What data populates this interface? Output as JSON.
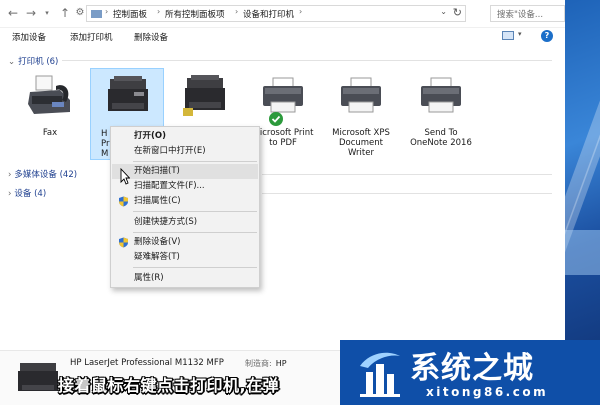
{
  "address": {
    "breadcrumbs": [
      "控制面板",
      "所有控制面板项",
      "设备和打印机"
    ],
    "search_placeholder": "搜索\"设备..."
  },
  "toolbar": {
    "add_device": "添加设备",
    "add_printer": "添加打印机",
    "remove_device": "删除设备"
  },
  "groups": {
    "printers": "打印机 (6)",
    "multimedia": "多媒体设备 (42)",
    "devices": "设备 (4)"
  },
  "devices": [
    {
      "label": "Fax",
      "icon": "fax-icon"
    },
    {
      "label": "H\nPr\nM",
      "icon": "mfp-printer-icon",
      "selected": true
    },
    {
      "label": "",
      "icon": "mfp-printer-icon"
    },
    {
      "label": "Microsoft Print\nto PDF",
      "icon": "printer-icon",
      "default": true
    },
    {
      "label": "Microsoft XPS\nDocument\nWriter",
      "icon": "printer-icon"
    },
    {
      "label": "Send To\nOneNote 2016",
      "icon": "printer-icon"
    }
  ],
  "context_menu": {
    "open": "打开(O)",
    "open_new_window": "在新窗口中打开(E)",
    "start_scan": "开始扫描(T)",
    "scan_profiles": "扫描配置文件(F)...",
    "scan_properties": "扫描属性(C)",
    "create_shortcut": "创建快捷方式(S)",
    "remove_device": "删除设备(V)",
    "troubleshoot": "疑难解答(T)",
    "properties": "属性(R)"
  },
  "details": {
    "device_name": "HP LaserJet Professional M1132 MFP",
    "manufacturer_label": "制造商:",
    "manufacturer": "HP"
  },
  "subtitle": "接着鼠标右键点击打印机,在弹",
  "watermark": {
    "title": "系统之城",
    "url": "xitong86.com"
  },
  "colors": {
    "selection": "#cce8ff",
    "group_header": "#1e3f8f",
    "watermark_bg": "#0f4fa8",
    "default_check": "#2c9a3c"
  }
}
